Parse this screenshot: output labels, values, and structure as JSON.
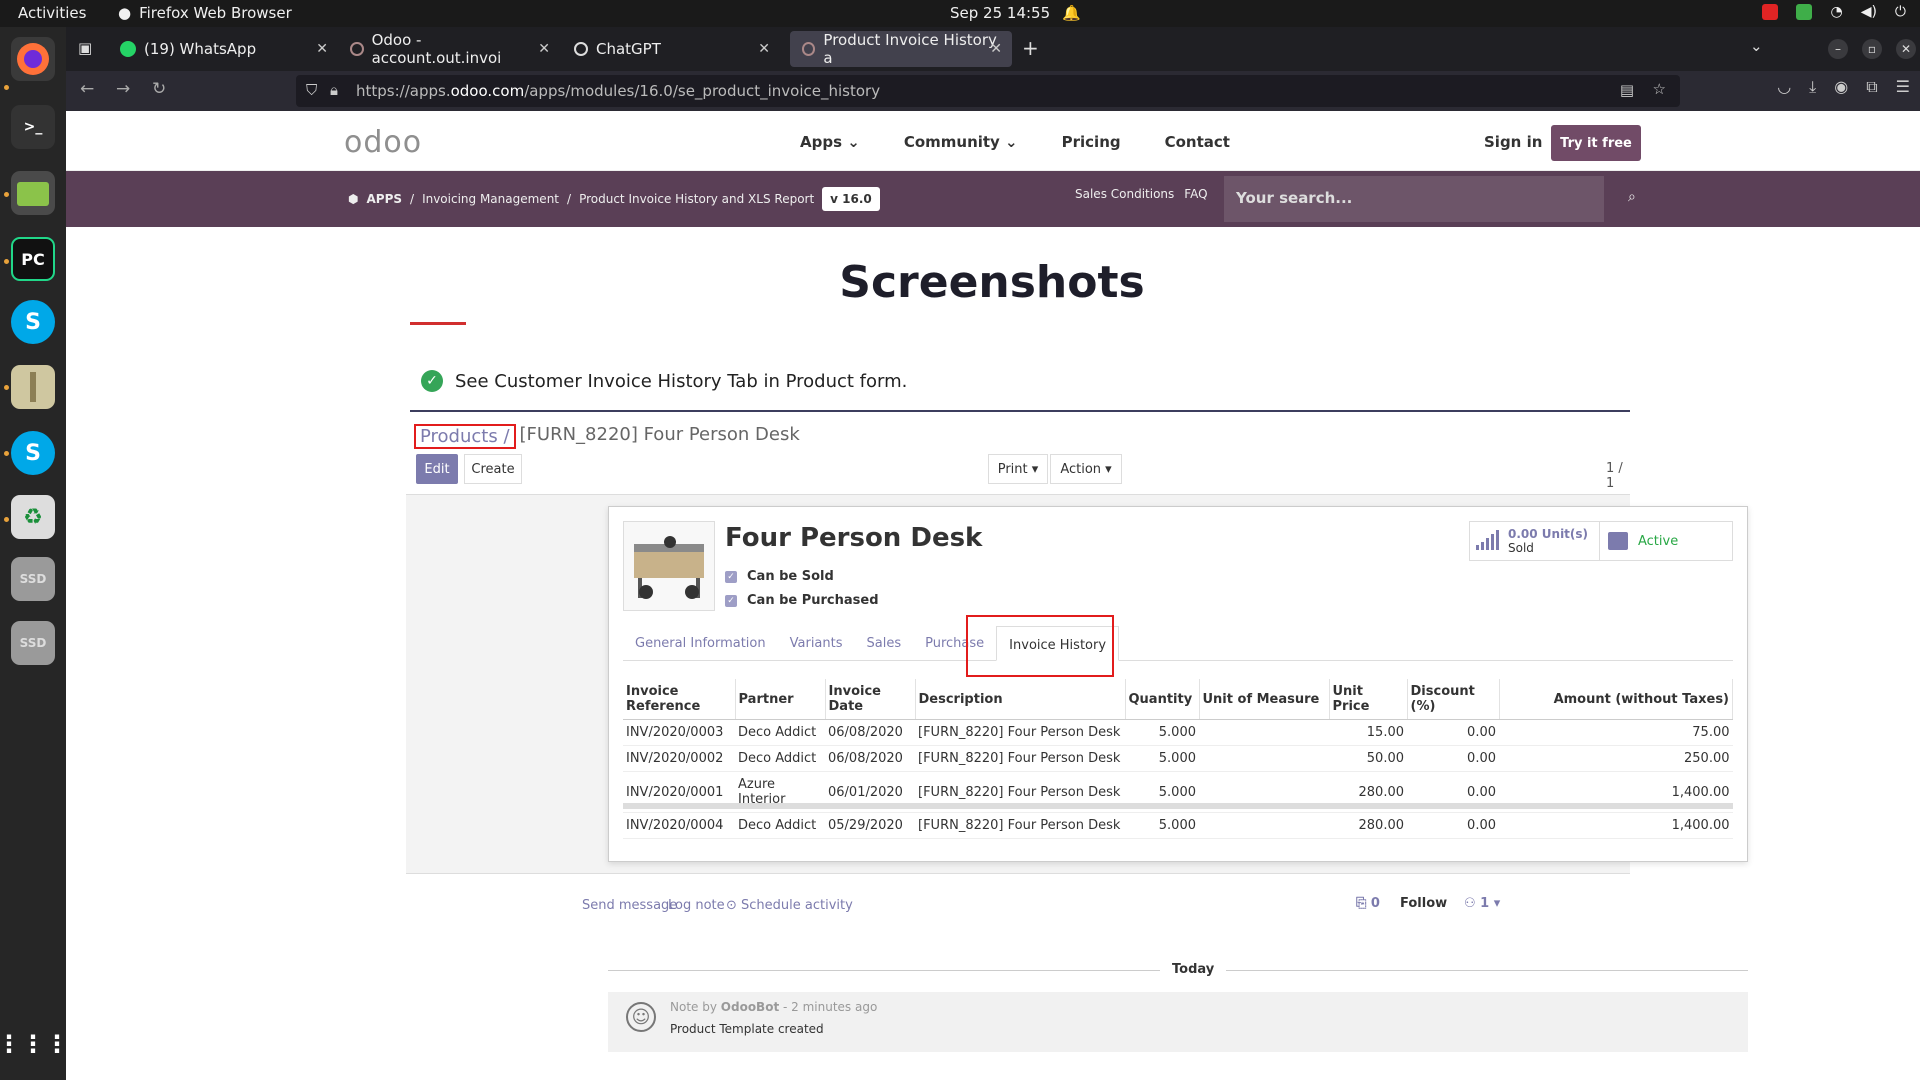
{
  "system": {
    "activities": "Activities",
    "app_name": "Firefox Web Browser",
    "clock": "Sep 25  14:55"
  },
  "browser": {
    "tabs": [
      {
        "label": "(19) WhatsApp"
      },
      {
        "label": "Odoo - account.out.invoi"
      },
      {
        "label": "ChatGPT"
      },
      {
        "label": "Product Invoice History a"
      }
    ],
    "new_tab": "+",
    "url_prefix": "https://apps.",
    "url_host": "odoo.com",
    "url_path": "/apps/modules/16.0/se_product_invoice_history"
  },
  "site": {
    "logo": "odoo",
    "nav": [
      "Apps ⌄",
      "Community ⌄",
      "Pricing",
      "Contact"
    ],
    "sign_in": "Sign in",
    "try_free": "Try it free",
    "breadcrumbs": [
      "APPS",
      "Invoicing Management",
      "Product Invoice History and XLS Report"
    ],
    "version": "v 16.0",
    "sales_conditions": "Sales Conditions",
    "faq": "FAQ",
    "search_placeholder": "Your search..."
  },
  "content": {
    "heading": "Screenshots",
    "feature": "See Customer Invoice History Tab in Product form."
  },
  "odoo_form": {
    "breadcrumb_parent": "Products /",
    "breadcrumb_current": "[FURN_8220] Four Person Desk",
    "edit": "Edit",
    "create": "Create",
    "print": "Print ▾",
    "action": "Action ▾",
    "pager": "1 / 1",
    "product_name": "Four Person Desk",
    "can_be_sold": "Can be Sold",
    "can_be_purchased": "Can be Purchased",
    "sold_value": "0.00 Unit(s)",
    "sold_label": "Sold",
    "active_label": "Active",
    "tabs": [
      "General Information",
      "Variants",
      "Sales",
      "Purchase",
      "Invoice History"
    ],
    "columns": [
      "Invoice Reference",
      "Partner",
      "Invoice Date",
      "Description",
      "Quantity",
      "Unit of Measure",
      "Unit Price",
      "Discount (%)",
      "Amount (without Taxes)"
    ],
    "rows": [
      [
        "INV/2020/0003",
        "Deco Addict",
        "06/08/2020",
        "[FURN_8220] Four Person Desk",
        "5.000",
        "",
        "15.00",
        "0.00",
        "75.00"
      ],
      [
        "INV/2020/0002",
        "Deco Addict",
        "06/08/2020",
        "[FURN_8220] Four Person Desk",
        "5.000",
        "",
        "50.00",
        "0.00",
        "250.00"
      ],
      [
        "INV/2020/0001",
        "Azure Interior",
        "06/01/2020",
        "[FURN_8220] Four Person Desk",
        "5.000",
        "",
        "280.00",
        "0.00",
        "1,400.00"
      ],
      [
        "INV/2020/0004",
        "Deco Addict",
        "05/29/2020",
        "[FURN_8220] Four Person Desk",
        "5.000",
        "",
        "280.00",
        "0.00",
        "1,400.00"
      ]
    ],
    "chatter": {
      "send_message": "Send message",
      "log_note": "Log note",
      "schedule_activity": "⊙ Schedule activity",
      "attachments": "⎘ 0",
      "follow": "Follow",
      "followers": "⚇ 1 ▾",
      "today": "Today",
      "note_prefix": "Note by",
      "note_author": "OdooBot",
      "note_time": "- 2 minutes ago",
      "note_body": "Product Template created"
    }
  }
}
